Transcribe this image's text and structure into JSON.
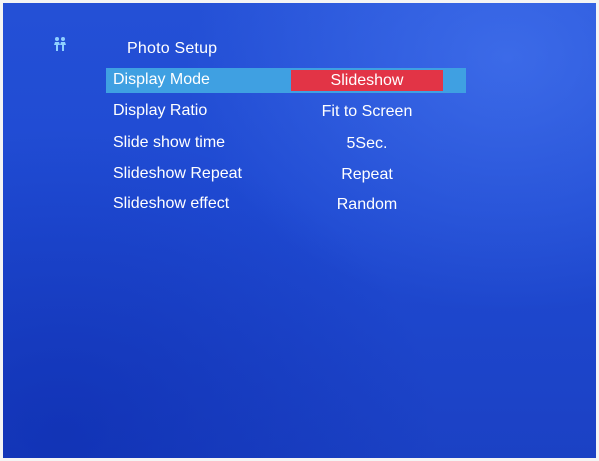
{
  "screen": {
    "icon": "people-icon",
    "title": "Photo Setup"
  },
  "menu": {
    "items": [
      {
        "label": "Display Mode",
        "value": "Slideshow",
        "selected": true
      },
      {
        "label": "Display Ratio",
        "value": "Fit to Screen",
        "selected": false
      },
      {
        "label": "Slide show time",
        "value": "5Sec.",
        "selected": false
      },
      {
        "label": "Slideshow Repeat",
        "value": "Repeat",
        "selected": false
      },
      {
        "label": "Slideshow effect",
        "value": "Random",
        "selected": false
      }
    ]
  },
  "colors": {
    "background": "#1f4ad2",
    "selected_row": "#3fa0e2",
    "selected_value": "#e23446",
    "text": "#ffffff"
  }
}
